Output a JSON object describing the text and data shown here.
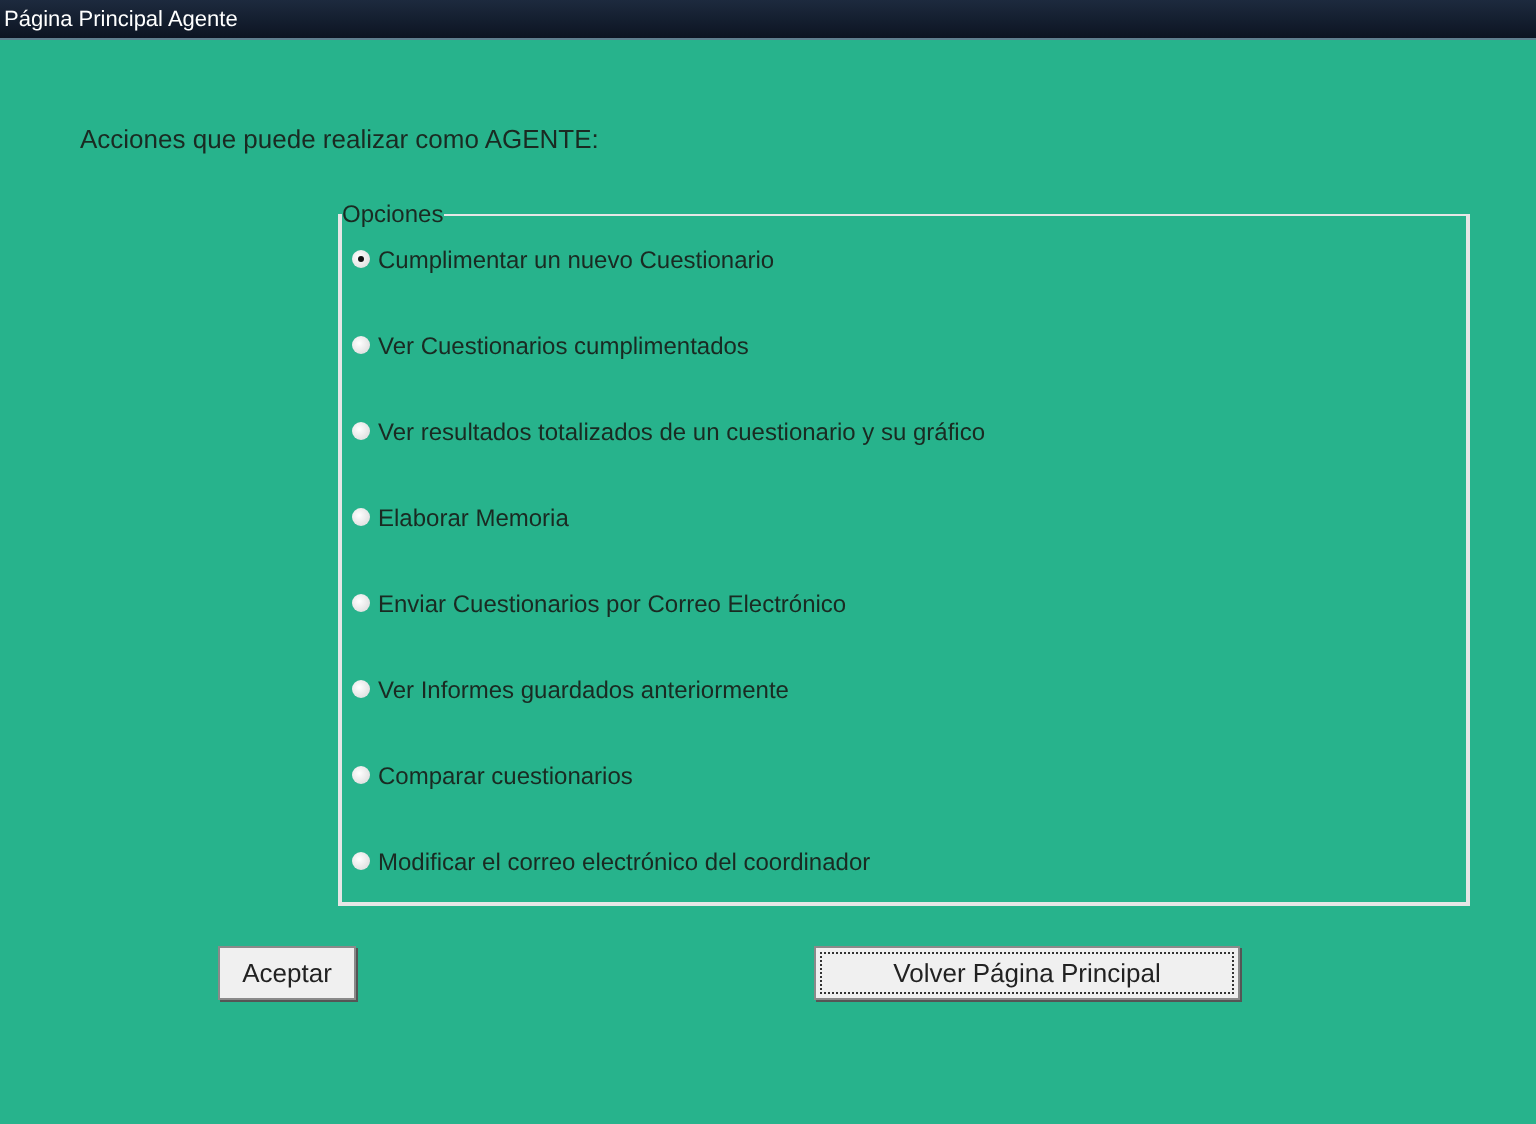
{
  "window": {
    "title": "Página Principal Agente"
  },
  "heading": "Acciones que puede realizar como AGENTE:",
  "group": {
    "legend": "Opciones",
    "options": [
      {
        "label": "Cumplimentar un nuevo Cuestionario",
        "selected": true
      },
      {
        "label": "Ver Cuestionarios cumplimentados",
        "selected": false
      },
      {
        "label": "Ver resultados totalizados de un cuestionario y su gráfico",
        "selected": false
      },
      {
        "label": "Elaborar Memoria",
        "selected": false
      },
      {
        "label": "Enviar Cuestionarios por Correo Electrónico",
        "selected": false
      },
      {
        "label": "Ver Informes guardados anteriormente",
        "selected": false
      },
      {
        "label": "Comparar cuestionarios",
        "selected": false
      },
      {
        "label": "Modificar el correo electrónico del coordinador",
        "selected": false
      }
    ]
  },
  "buttons": [
    {
      "label": "Aceptar",
      "focused": false
    },
    {
      "label": "Volver Página Principal",
      "focused": true
    }
  ]
}
